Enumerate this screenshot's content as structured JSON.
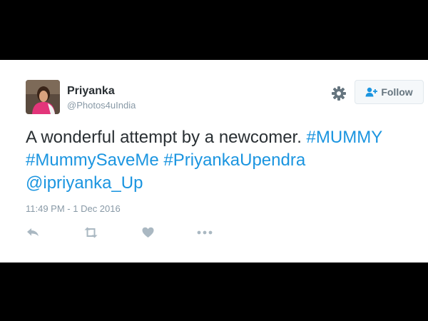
{
  "tweet": {
    "author": {
      "display_name": "Priyanka",
      "handle": "@Photos4uIndia",
      "avatar": "avatar-photo"
    },
    "follow_button": {
      "label": "Follow",
      "icon": "add-person-icon"
    },
    "settings_icon": "gear-icon",
    "text": {
      "plain": "A wonderful attempt by a newcomer. ",
      "hashtag_1": "#MUMMY",
      "hashtag_2": "#MummySaveMe",
      "hashtag_3": "#PriyankaUpendra",
      "mention": "@ipriyanka_Up"
    },
    "timestamp": "11:49 PM - 1 Dec 2016",
    "actions": [
      "reply-icon",
      "retweet-icon",
      "like-icon",
      "more-icon"
    ]
  },
  "colors": {
    "background": "#000000",
    "card": "#ffffff",
    "text": "#292f33",
    "muted": "#8899a6",
    "link": "#1b95e0",
    "icon": "#aab8c2"
  }
}
